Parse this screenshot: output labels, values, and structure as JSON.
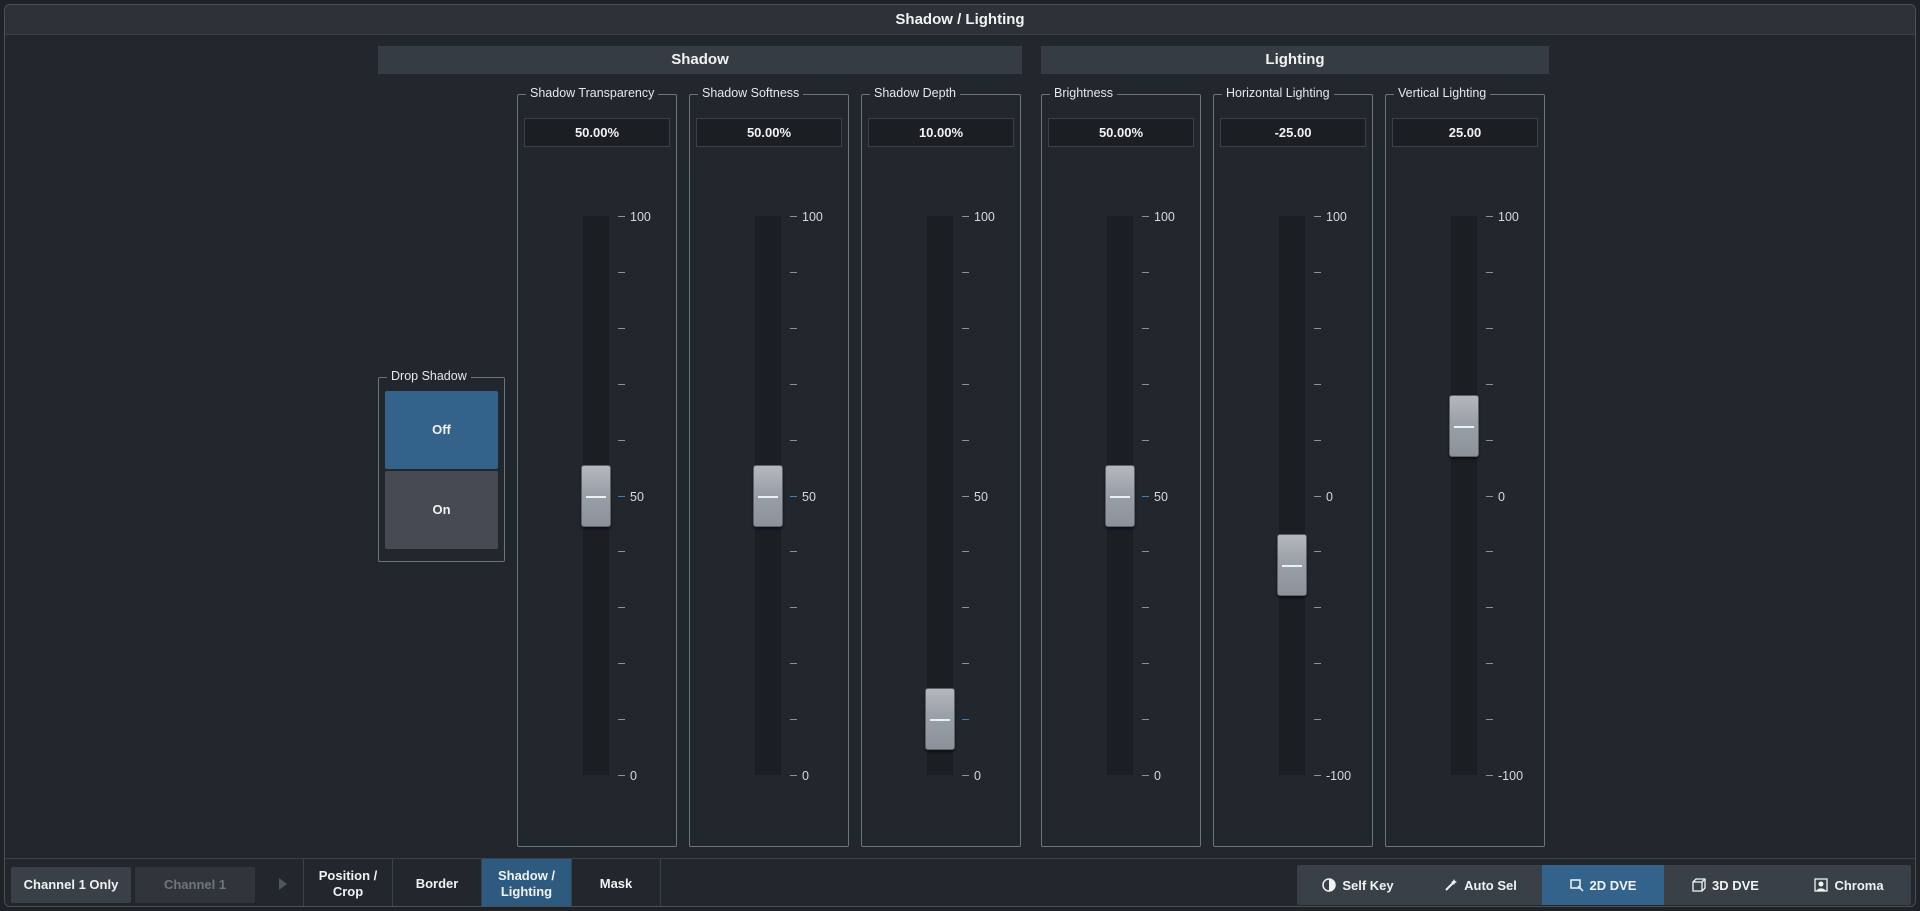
{
  "window": {
    "title": "Shadow / Lighting"
  },
  "sections": {
    "shadow": "Shadow",
    "lighting": "Lighting"
  },
  "drop_shadow": {
    "label": "Drop Shadow",
    "off": "Off",
    "on": "On",
    "selected": "Off"
  },
  "faders": [
    {
      "label": "Shadow Transparency",
      "value_text": "50.00%",
      "value": 50,
      "min": 0,
      "max": 100,
      "ticks": [
        "100",
        "50",
        "0"
      ]
    },
    {
      "label": "Shadow Softness",
      "value_text": "50.00%",
      "value": 50,
      "min": 0,
      "max": 100,
      "ticks": [
        "100",
        "50",
        "0"
      ]
    },
    {
      "label": "Shadow Depth",
      "value_text": "10.00%",
      "value": 10,
      "min": 0,
      "max": 100,
      "ticks": [
        "100",
        "50",
        "0"
      ]
    },
    {
      "label": "Brightness",
      "value_text": "50.00%",
      "value": 50,
      "min": 0,
      "max": 100,
      "ticks": [
        "100",
        "50",
        "0"
      ]
    },
    {
      "label": "Horizontal Lighting",
      "value_text": "-25.00",
      "value": -25,
      "min": -100,
      "max": 100,
      "ticks": [
        "100",
        "0",
        "-100"
      ]
    },
    {
      "label": "Vertical Lighting",
      "value_text": "25.00",
      "value": 25,
      "min": -100,
      "max": 100,
      "ticks": [
        "100",
        "0",
        "-100"
      ]
    }
  ],
  "bottom": {
    "channel_only": "Channel 1 Only",
    "channel": "Channel 1",
    "tabs": [
      "Position /\nCrop",
      "Border",
      "Shadow /\nLighting",
      "Mask"
    ],
    "active_tab": "Shadow /\nLighting",
    "right_buttons": [
      {
        "label": "Self Key",
        "icon": "half-circle-icon"
      },
      {
        "label": "Auto Sel",
        "icon": "wand-icon"
      },
      {
        "label": "2D DVE",
        "icon": "2d-dve-icon",
        "active": true
      },
      {
        "label": "3D DVE",
        "icon": "3d-cube-icon"
      },
      {
        "label": "Chroma",
        "icon": "person-icon"
      }
    ]
  },
  "colors": {
    "accent": "#33628a",
    "tab_active": "#2e5a80",
    "background": "#22272d"
  }
}
